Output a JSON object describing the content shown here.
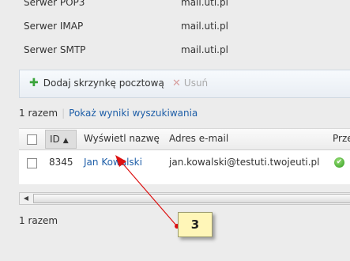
{
  "servers": [
    {
      "label": "Serwer POP3",
      "value": "mail.uti.pl"
    },
    {
      "label": "Serwer IMAP",
      "value": "mail.uti.pl"
    },
    {
      "label": "Serwer SMTP",
      "value": "mail.uti.pl"
    }
  ],
  "toolbar": {
    "add_label": "Dodaj skrzynkę pocztową",
    "delete_label": "Usuń"
  },
  "results": {
    "count": "1 razem",
    "show_search_link": "Pokaż wyniki wyszukiwania"
  },
  "table": {
    "columns": [
      "ID",
      "Wyświetl nazwę",
      "Adres e-mail",
      "Prze"
    ],
    "rows": [
      {
        "id": "8345",
        "name": "Jan Kowalski",
        "email": "jan.kowalski@testuti.twojeuti.pl",
        "status": "ok"
      }
    ]
  },
  "footer": {
    "count": "1 razem"
  },
  "annotation": {
    "label": "3"
  },
  "colors": {
    "link": "#1f5fa8",
    "callout_bg": "#fff6b8",
    "arrow": "#dd1111",
    "add_icon": "#3aa43a"
  }
}
